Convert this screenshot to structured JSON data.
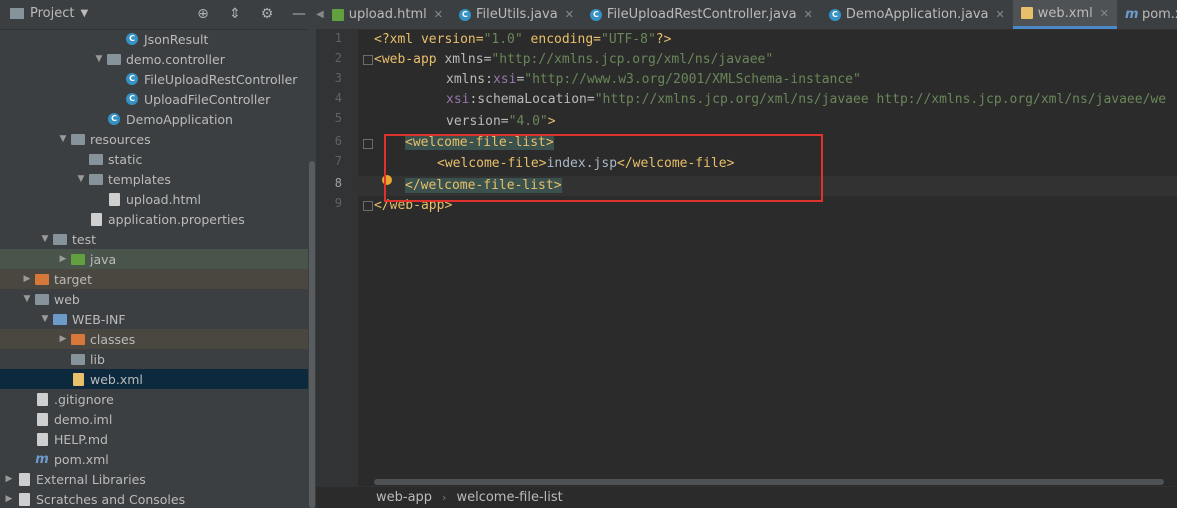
{
  "project_panel": {
    "title": "Project",
    "tools": [
      "crosshair-icon",
      "collapse-icon",
      "gear-icon",
      "minimize-icon"
    ]
  },
  "tree": [
    {
      "label": "JsonResult",
      "icon": "class-icon",
      "indent": 128,
      "arrow": ""
    },
    {
      "label": "demo.controller",
      "icon": "package-icon",
      "indent": 110,
      "arrow": "down"
    },
    {
      "label": "FileUploadRestController",
      "icon": "class-icon",
      "indent": 128,
      "arrow": ""
    },
    {
      "label": "UploadFileController",
      "icon": "class-icon",
      "indent": 128,
      "arrow": ""
    },
    {
      "label": "DemoApplication",
      "icon": "spring-class-icon",
      "indent": 110,
      "arrow": ""
    },
    {
      "label": "resources",
      "icon": "resources-folder-icon",
      "indent": 74,
      "arrow": "down"
    },
    {
      "label": "static",
      "icon": "folder-icon",
      "indent": 92,
      "arrow": ""
    },
    {
      "label": "templates",
      "icon": "folder-icon",
      "indent": 92,
      "arrow": "down"
    },
    {
      "label": "upload.html",
      "icon": "html-file-icon",
      "indent": 110,
      "arrow": ""
    },
    {
      "label": "application.properties",
      "icon": "properties-file-icon",
      "indent": 92,
      "arrow": ""
    },
    {
      "label": "test",
      "icon": "folder-icon",
      "indent": 56,
      "arrow": "down"
    },
    {
      "label": "java",
      "icon": "test-folder-icon",
      "indent": 74,
      "arrow": "right"
    },
    {
      "label": "target",
      "icon": "target-folder-icon",
      "indent": 38,
      "arrow": "right"
    },
    {
      "label": "web",
      "icon": "folder-icon",
      "indent": 38,
      "arrow": "down"
    },
    {
      "label": "WEB-INF",
      "icon": "web-folder-icon",
      "indent": 56,
      "arrow": "down"
    },
    {
      "label": "classes",
      "icon": "excluded-folder-icon",
      "indent": 74,
      "arrow": "right"
    },
    {
      "label": "lib",
      "icon": "folder-icon",
      "indent": 74,
      "arrow": ""
    },
    {
      "label": "web.xml",
      "icon": "xml-file-icon",
      "indent": 74,
      "arrow": ""
    },
    {
      "label": ".gitignore",
      "icon": "gitignore-file-icon",
      "indent": 38,
      "arrow": ""
    },
    {
      "label": "demo.iml",
      "icon": "iml-file-icon",
      "indent": 38,
      "arrow": ""
    },
    {
      "label": "HELP.md",
      "icon": "markdown-file-icon",
      "indent": 38,
      "arrow": ""
    },
    {
      "label": "pom.xml",
      "icon": "maven-file-icon",
      "indent": 38,
      "arrow": ""
    },
    {
      "label": "External Libraries",
      "icon": "libraries-icon",
      "indent": 20,
      "arrow": "right"
    },
    {
      "label": "Scratches and Consoles",
      "icon": "scratches-icon",
      "indent": 20,
      "arrow": "right"
    }
  ],
  "tabs": [
    {
      "label": "upload.html",
      "icon": "html"
    },
    {
      "label": "FileUtils.java",
      "icon": "class"
    },
    {
      "label": "FileUploadRestController.java",
      "icon": "class"
    },
    {
      "label": "DemoApplication.java",
      "icon": "class"
    },
    {
      "label": "web.xml",
      "icon": "xml",
      "active": true
    },
    {
      "label": "pom.xml (demo",
      "icon": "m"
    }
  ],
  "code": {
    "line_numbers": [
      "1",
      "2",
      "3",
      "4",
      "5",
      "6",
      "7",
      "8",
      "9"
    ],
    "l1": {
      "open": "<?xml version=",
      "v1": "\"1.0\"",
      "mid": " encoding=",
      "v2": "\"UTF-8\"",
      "close": "?>"
    },
    "l2": {
      "tag": "<web-app",
      "attr": " xmlns=",
      "val": "\"http://xmlns.jcp.org/xml/ns/javaee\""
    },
    "l3": {
      "attr": "xmlns:",
      "ns": "xsi",
      "eq": "=",
      "val": "\"http://www.w3.org/2001/XMLSchema-instance\""
    },
    "l4": {
      "ns": "xsi",
      "attr": ":schemaLocation=",
      "val": "\"http://xmlns.jcp.org/xml/ns/javaee http://xmlns.jcp.org/xml/ns/javaee/we"
    },
    "l5": {
      "attr": "version=",
      "val": "\"4.0\"",
      "close": ">"
    },
    "l6": {
      "tag": "<welcome-file-list>"
    },
    "l7": {
      "open": "<welcome-file>",
      "text": "index.jsp",
      "close": "</welcome-file>"
    },
    "l8": {
      "tag": "</welcome-file-list>"
    },
    "l9": {
      "tag": "</web-app>"
    }
  },
  "breadcrumb": [
    "web-app",
    "welcome-file-list"
  ],
  "colors": {
    "highlight_box": "#e0322d",
    "active_tab_underline": "#4a88c7",
    "selected_row": "#0d293e"
  }
}
